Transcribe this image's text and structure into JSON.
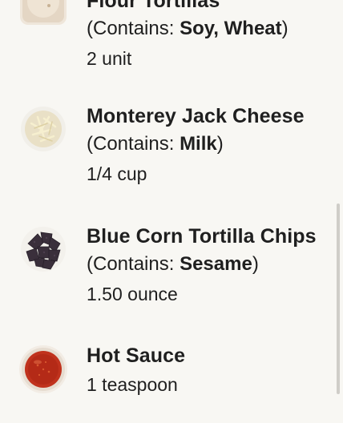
{
  "ingredients": [
    {
      "name": "Flour Tortillas",
      "allergen_prefix": "(Contains: ",
      "allergens": "Soy, Wheat",
      "allergen_suffix": ")",
      "quantity": "2 unit",
      "image_icon": "flour-tortilla-image"
    },
    {
      "name": "Monterey Jack Cheese",
      "allergen_prefix": "(Contains: ",
      "allergens": "Milk",
      "allergen_suffix": ")",
      "quantity": "1/4 cup",
      "image_icon": "shredded-cheese-image"
    },
    {
      "name": "Blue Corn Tortilla Chips",
      "allergen_prefix": "(Contains: ",
      "allergens": "Sesame",
      "allergen_suffix": ")",
      "quantity": "1.50 ounce",
      "image_icon": "tortilla-chips-image"
    },
    {
      "name": "Hot Sauce",
      "quantity": "1 teaspoon",
      "image_icon": "hot-sauce-image"
    }
  ],
  "colors": {
    "background": "#f8f7f3",
    "text": "#1f1f1f",
    "scrollbar": "#cfcdc8"
  }
}
